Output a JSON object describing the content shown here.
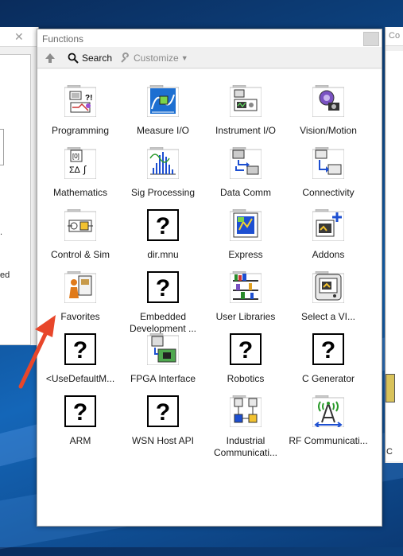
{
  "palette": {
    "title": "Functions",
    "toolbar": {
      "search_label": "Search",
      "customize_label": "Customize"
    },
    "items": [
      {
        "label": "Programming",
        "icon": "programming-icon"
      },
      {
        "label": "Measure I/O",
        "icon": "measure-io-icon"
      },
      {
        "label": "Instrument I/O",
        "icon": "instrument-io-icon"
      },
      {
        "label": "Vision/Motion",
        "icon": "vision-motion-icon"
      },
      {
        "label": "Mathematics",
        "icon": "mathematics-icon"
      },
      {
        "label": "Sig Processing",
        "icon": "sig-processing-icon"
      },
      {
        "label": "Data Comm",
        "icon": "data-comm-icon"
      },
      {
        "label": "Connectivity",
        "icon": "connectivity-icon"
      },
      {
        "label": "Control & Sim",
        "icon": "control-sim-icon"
      },
      {
        "label": "dir.mnu",
        "icon": "question-mark-icon"
      },
      {
        "label": "Express",
        "icon": "express-icon"
      },
      {
        "label": "Addons",
        "icon": "addons-icon"
      },
      {
        "label": "Favorites",
        "icon": "favorites-icon"
      },
      {
        "label": "Embedded Development ...",
        "icon": "question-mark-icon"
      },
      {
        "label": "User Libraries",
        "icon": "user-libraries-icon"
      },
      {
        "label": "Select a VI...",
        "icon": "select-vi-icon"
      },
      {
        "label": "<UseDefaultM...",
        "icon": "question-mark-icon"
      },
      {
        "label": "FPGA Interface",
        "icon": "fpga-interface-icon"
      },
      {
        "label": "Robotics",
        "icon": "question-mark-icon"
      },
      {
        "label": "C Generator",
        "icon": "question-mark-icon"
      },
      {
        "label": "ARM",
        "icon": "question-mark-icon"
      },
      {
        "label": "WSN Host API",
        "icon": "question-mark-icon"
      },
      {
        "label": "Industrial Communicati...",
        "icon": "industrial-comm-icon"
      },
      {
        "label": "RF Communicati...",
        "icon": "rf-comm-icon"
      }
    ]
  },
  "background_windows": {
    "left_fragments": [
      ".",
      "ed"
    ],
    "right_title": "Co",
    "right_fragment": "C"
  },
  "colors": {
    "annotation_arrow": "#e8462a",
    "desktop": "#0e4a8c"
  }
}
